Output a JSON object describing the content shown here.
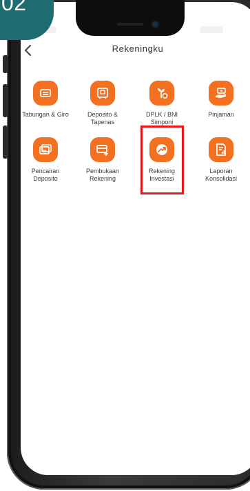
{
  "step_badge": {
    "label": "02"
  },
  "header": {
    "title": "Rekeningku"
  },
  "menu": {
    "items": [
      {
        "label": "Tabungan & Giro",
        "icon": "wallet-icon"
      },
      {
        "label": "Deposito &\nTapenas",
        "icon": "safe-icon"
      },
      {
        "label": "DPLK / BNI\nSimponi",
        "icon": "plant-coin-icon"
      },
      {
        "label": "Pinjaman",
        "icon": "hand-money-icon"
      },
      {
        "label": "Pencairan\nDeposito",
        "icon": "cash-icon"
      },
      {
        "label": "Pembukaan\nRekening",
        "icon": "card-plus-icon"
      },
      {
        "label": "Rekening\nInvestasi",
        "icon": "trend-up-icon"
      },
      {
        "label": "Laporan\nKonsolidasi",
        "icon": "report-icon"
      }
    ]
  },
  "colors": {
    "accent": "#f37021",
    "badge": "#1e6b70",
    "highlight": "#e41a1a"
  }
}
